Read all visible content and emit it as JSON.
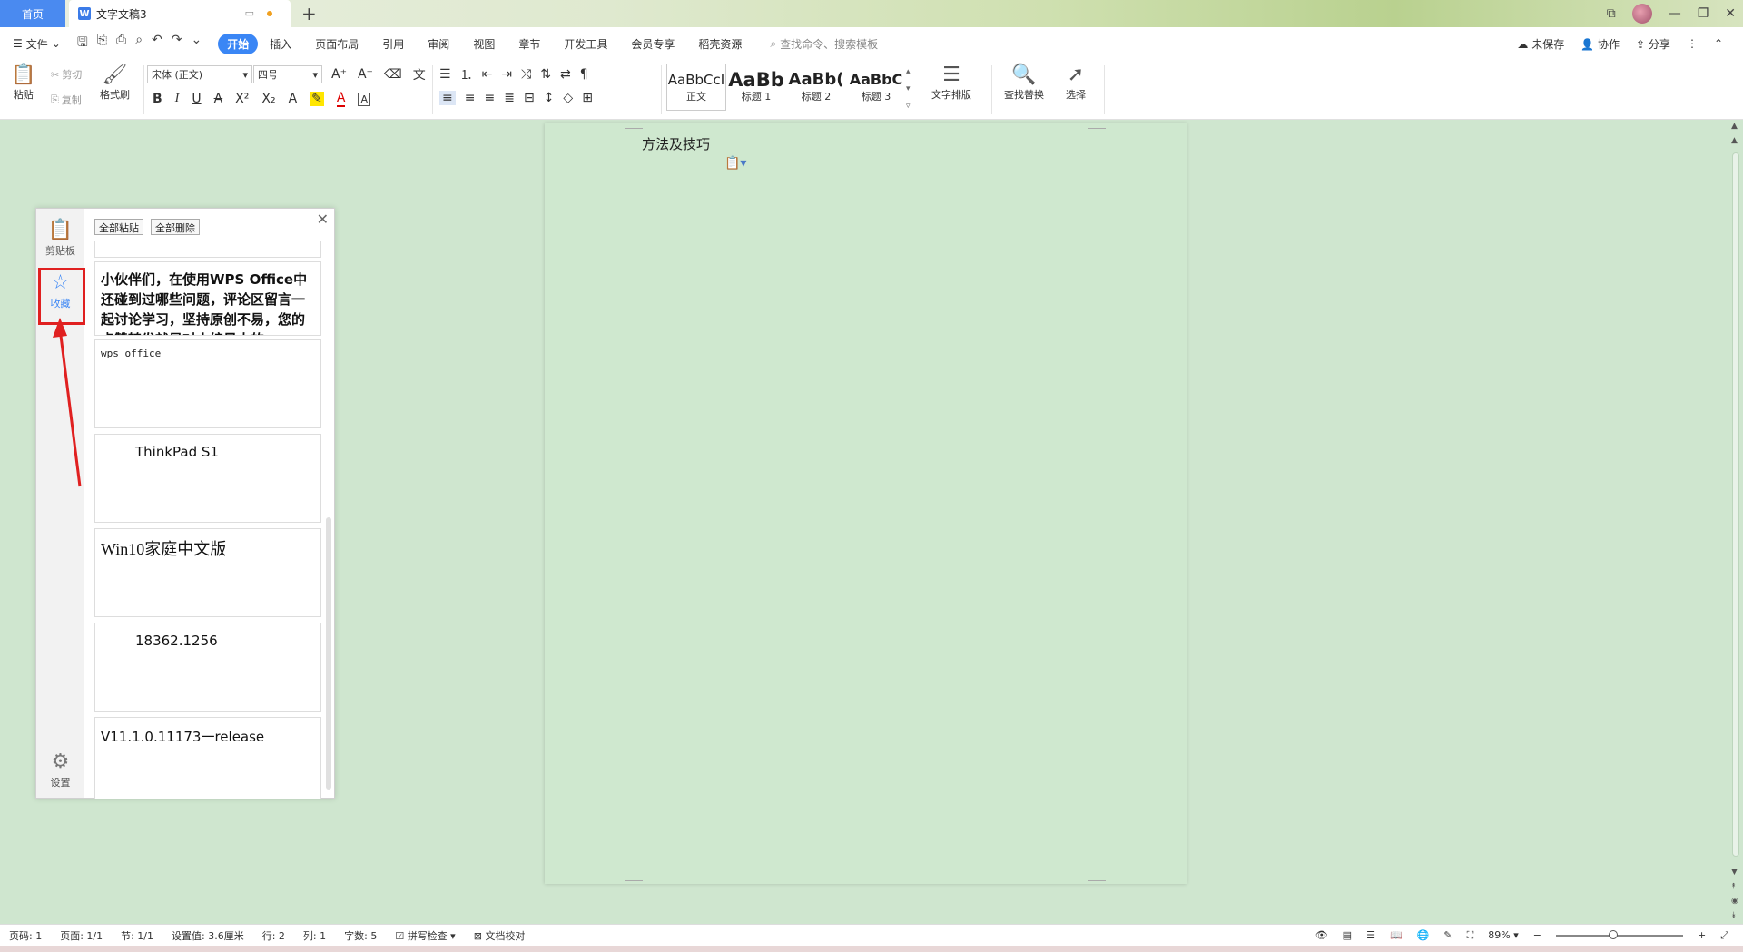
{
  "titlebar": {
    "home_tab": "首页",
    "doc_tab": "文字文稿3",
    "doc_icon": "W",
    "add_tab": "+"
  },
  "menubar": {
    "file": "文件",
    "tabs": [
      "开始",
      "插入",
      "页面布局",
      "引用",
      "审阅",
      "视图",
      "章节",
      "开发工具",
      "会员专享",
      "稻壳资源"
    ],
    "search_placeholder": "查找命令、搜索模板",
    "unsaved": "未保存",
    "collaborate": "协作",
    "share": "分享"
  },
  "ribbon": {
    "paste": "粘贴",
    "cut": "剪切",
    "copy": "复制",
    "format_painter": "格式刷",
    "font_name": "宋体 (正文)",
    "font_size": "四号",
    "styles": [
      {
        "sample": "AaBbCcI",
        "label": "正文"
      },
      {
        "sample": "AaBb",
        "label": "标题 1"
      },
      {
        "sample": "AaBb(",
        "label": "标题 2"
      },
      {
        "sample": "AaBbC",
        "label": "标题 3"
      }
    ],
    "text_layout": "文字排版",
    "find_replace": "查找替换",
    "select": "选择"
  },
  "document": {
    "text": "方法及技巧"
  },
  "clipboard_panel": {
    "side_clipboard": "剪贴板",
    "side_favorites": "收藏",
    "side_settings": "设置",
    "paste_all": "全部粘贴",
    "delete_all": "全部删除",
    "items": [
      "小伙伴们，在使用WPS Office中还碰到过哪些问题，评论区留言一起讨论学习，坚持原创不易，您的点赞转发就是对小编最大的",
      "wps office",
      "ThinkPad S1",
      "Win10家庭中文版",
      "18362.1256",
      "V11.1.0.11173一release"
    ]
  },
  "statusbar": {
    "page_no": "页码: 1",
    "pages": "页面: 1/1",
    "section": "节: 1/1",
    "setting": "设置值: 3.6厘米",
    "row": "行: 2",
    "col": "列: 1",
    "words": "字数: 5",
    "spell": "拼写检查",
    "proof": "文档校对",
    "zoom": "89%"
  }
}
